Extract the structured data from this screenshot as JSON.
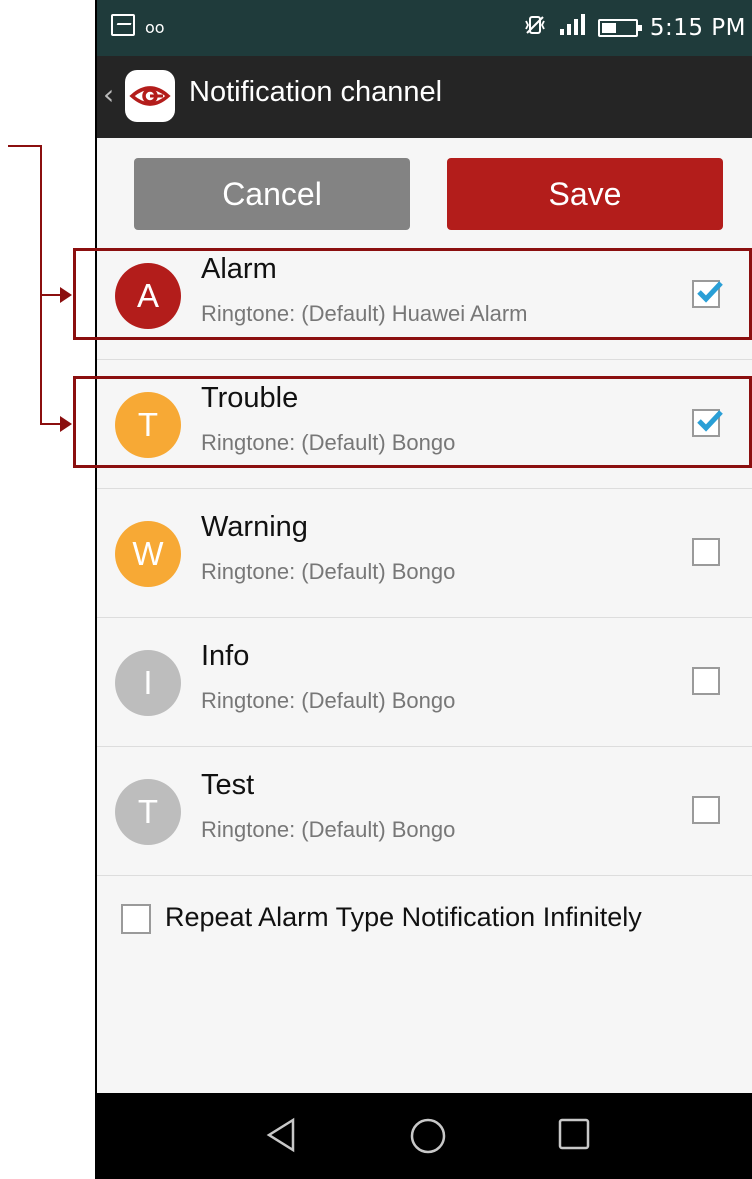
{
  "status_bar": {
    "time": "5:15 PM",
    "left_icons": [
      "gallery-icon",
      "voicemail-icon"
    ],
    "right_icons": [
      "vibrate-icon",
      "signal-icon",
      "battery-icon"
    ],
    "voicemail_glyph": "oo"
  },
  "app_bar": {
    "title": "Notification channel",
    "back_glyph": "‹"
  },
  "buttons": {
    "cancel": "Cancel",
    "save": "Save"
  },
  "channels": [
    {
      "letter": "A",
      "title": "Alarm",
      "ringtone": "Ringtone: (Default) Huawei Alarm",
      "checked": true,
      "color": "#b31d1b"
    },
    {
      "letter": "T",
      "title": "Trouble",
      "ringtone": "Ringtone: (Default) Bongo",
      "checked": true,
      "color": "#f7a935"
    },
    {
      "letter": "W",
      "title": "Warning",
      "ringtone": "Ringtone: (Default) Bongo",
      "checked": false,
      "color": "#f7a935"
    },
    {
      "letter": "I",
      "title": "Info",
      "ringtone": "Ringtone: (Default) Bongo",
      "checked": false,
      "color": "#bdbdbd"
    },
    {
      "letter": "T",
      "title": "Test",
      "ringtone": "Ringtone: (Default) Bongo",
      "checked": false,
      "color": "#bdbdbd"
    }
  ],
  "repeat_option": {
    "label": "Repeat Alarm Type Notification Infinitely",
    "checked": false
  },
  "colors": {
    "status_bar": "#1f3b3b",
    "app_bar": "#252525",
    "save_button": "#b31d1b",
    "cancel_button": "#838383",
    "checkmark": "#2a9fd6",
    "callout": "#8b0f0f"
  },
  "nav_bar": {
    "icons": [
      "back-triangle-icon",
      "home-circle-icon",
      "recents-square-icon"
    ]
  }
}
